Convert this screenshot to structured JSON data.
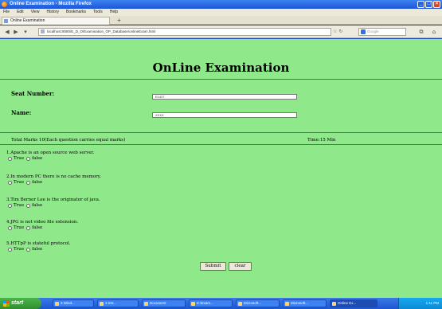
{
  "window": {
    "title": "Online Examination - Mozilla Firefox"
  },
  "menu": [
    "File",
    "Edit",
    "View",
    "History",
    "Bookmarks",
    "Tools",
    "Help"
  ],
  "tab": {
    "label": "Online Examination",
    "new_tab": "+"
  },
  "nav": {
    "url": "localhost:8080/E_D_O/Examination_OP_Database/onlineExam.html",
    "search_placeholder": "Google"
  },
  "exam": {
    "title": "OnLine Examination",
    "seat_label": "Seat Number:",
    "seat_value": "E1427",
    "name_label": "Name:",
    "name_value": "XXXX",
    "marks_text": "Total Marks 10(Each question carries equal marks)",
    "time_text": "Time:15 Min",
    "true_label": "True",
    "false_label": "false",
    "questions": [
      "1.Apache is an open source web server.",
      "2.In modern PC there is no cache memory.",
      "3.Tim Berner Lee is the originator of java.",
      "4.JPG is not video file extension.",
      "5.HTTpP is stateful protocol."
    ],
    "submit_label": "Submit",
    "clear_label": "clear"
  },
  "taskbar": {
    "start_label": "start",
    "tasks": [
      "3 Wind...",
      "3 Intr...",
      "Document",
      "E:\\Exam...",
      "Microsoft...",
      "Microsoft...",
      "Online Ex..."
    ],
    "clock": "1:11 PM"
  }
}
